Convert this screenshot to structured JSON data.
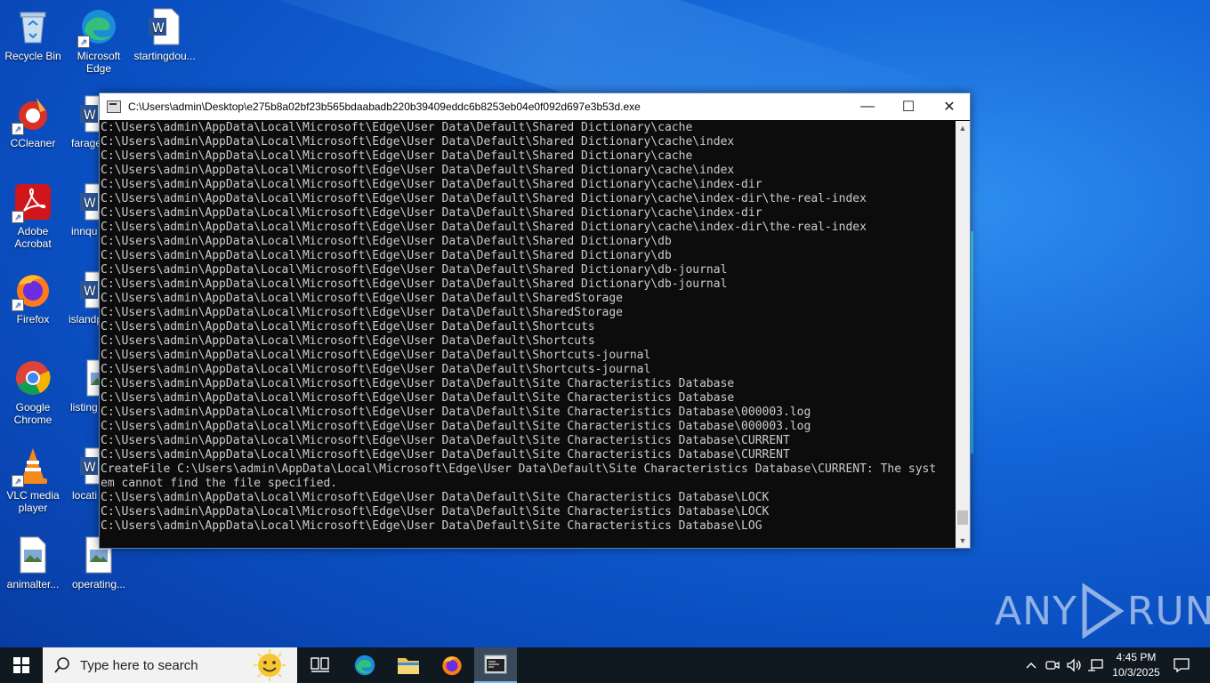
{
  "desktop": {
    "icons": [
      {
        "label": "Recycle Bin",
        "icon": "recycle-bin-icon"
      },
      {
        "label": "Microsoft Edge",
        "icon": "edge-icon"
      },
      {
        "label": "startingdou...",
        "icon": "word-doc-icon"
      },
      {
        "label": "CCleaner",
        "icon": "ccleaner-icon"
      },
      {
        "label": "farage",
        "icon": "word-doc-icon"
      },
      {
        "label": "Adobe Acrobat",
        "icon": "acrobat-icon"
      },
      {
        "label": "innqu",
        "icon": "word-doc-icon"
      },
      {
        "label": "Firefox",
        "icon": "firefox-icon"
      },
      {
        "label": "islandp",
        "icon": "word-doc-icon"
      },
      {
        "label": "Google Chrome",
        "icon": "chrome-icon"
      },
      {
        "label": "listing",
        "icon": "image-file-icon"
      },
      {
        "label": "VLC media player",
        "icon": "vlc-icon"
      },
      {
        "label": "locati",
        "icon": "word-doc-icon"
      },
      {
        "label": "animalter...",
        "icon": "image-file-icon"
      },
      {
        "label": "operating...",
        "icon": "image-file-icon"
      }
    ]
  },
  "console_window": {
    "title": "C:\\Users\\admin\\Desktop\\e275b8a02bf23b565bdaabadb220b39409eddc6b8253eb04e0f092d697e3b53d.exe",
    "minimize": "—",
    "maximize": "☐",
    "close": "✕",
    "lines": [
      "C:\\Users\\admin\\AppData\\Local\\Microsoft\\Edge\\User Data\\Default\\Shared Dictionary\\cache",
      "C:\\Users\\admin\\AppData\\Local\\Microsoft\\Edge\\User Data\\Default\\Shared Dictionary\\cache\\index",
      "C:\\Users\\admin\\AppData\\Local\\Microsoft\\Edge\\User Data\\Default\\Shared Dictionary\\cache",
      "C:\\Users\\admin\\AppData\\Local\\Microsoft\\Edge\\User Data\\Default\\Shared Dictionary\\cache\\index",
      "C:\\Users\\admin\\AppData\\Local\\Microsoft\\Edge\\User Data\\Default\\Shared Dictionary\\cache\\index-dir",
      "C:\\Users\\admin\\AppData\\Local\\Microsoft\\Edge\\User Data\\Default\\Shared Dictionary\\cache\\index-dir\\the-real-index",
      "C:\\Users\\admin\\AppData\\Local\\Microsoft\\Edge\\User Data\\Default\\Shared Dictionary\\cache\\index-dir",
      "C:\\Users\\admin\\AppData\\Local\\Microsoft\\Edge\\User Data\\Default\\Shared Dictionary\\cache\\index-dir\\the-real-index",
      "C:\\Users\\admin\\AppData\\Local\\Microsoft\\Edge\\User Data\\Default\\Shared Dictionary\\db",
      "C:\\Users\\admin\\AppData\\Local\\Microsoft\\Edge\\User Data\\Default\\Shared Dictionary\\db",
      "C:\\Users\\admin\\AppData\\Local\\Microsoft\\Edge\\User Data\\Default\\Shared Dictionary\\db-journal",
      "C:\\Users\\admin\\AppData\\Local\\Microsoft\\Edge\\User Data\\Default\\Shared Dictionary\\db-journal",
      "C:\\Users\\admin\\AppData\\Local\\Microsoft\\Edge\\User Data\\Default\\SharedStorage",
      "C:\\Users\\admin\\AppData\\Local\\Microsoft\\Edge\\User Data\\Default\\SharedStorage",
      "C:\\Users\\admin\\AppData\\Local\\Microsoft\\Edge\\User Data\\Default\\Shortcuts",
      "C:\\Users\\admin\\AppData\\Local\\Microsoft\\Edge\\User Data\\Default\\Shortcuts",
      "C:\\Users\\admin\\AppData\\Local\\Microsoft\\Edge\\User Data\\Default\\Shortcuts-journal",
      "C:\\Users\\admin\\AppData\\Local\\Microsoft\\Edge\\User Data\\Default\\Shortcuts-journal",
      "C:\\Users\\admin\\AppData\\Local\\Microsoft\\Edge\\User Data\\Default\\Site Characteristics Database",
      "C:\\Users\\admin\\AppData\\Local\\Microsoft\\Edge\\User Data\\Default\\Site Characteristics Database",
      "C:\\Users\\admin\\AppData\\Local\\Microsoft\\Edge\\User Data\\Default\\Site Characteristics Database\\000003.log",
      "C:\\Users\\admin\\AppData\\Local\\Microsoft\\Edge\\User Data\\Default\\Site Characteristics Database\\000003.log",
      "C:\\Users\\admin\\AppData\\Local\\Microsoft\\Edge\\User Data\\Default\\Site Characteristics Database\\CURRENT",
      "C:\\Users\\admin\\AppData\\Local\\Microsoft\\Edge\\User Data\\Default\\Site Characteristics Database\\CURRENT",
      "CreateFile C:\\Users\\admin\\AppData\\Local\\Microsoft\\Edge\\User Data\\Default\\Site Characteristics Database\\CURRENT: The syst",
      "em cannot find the file specified.",
      "C:\\Users\\admin\\AppData\\Local\\Microsoft\\Edge\\User Data\\Default\\Site Characteristics Database\\LOCK",
      "C:\\Users\\admin\\AppData\\Local\\Microsoft\\Edge\\User Data\\Default\\Site Characteristics Database\\LOCK",
      "C:\\Users\\admin\\AppData\\Local\\Microsoft\\Edge\\User Data\\Default\\Site Characteristics Database\\LOG"
    ]
  },
  "taskbar": {
    "search_placeholder": "Type here to search",
    "apps": [
      "task-view-icon",
      "edge-icon",
      "file-explorer-icon",
      "firefox-icon",
      "console-icon"
    ],
    "tray_icons": [
      "chevron-up-icon",
      "meet-now-icon",
      "volume-icon",
      "network-icon"
    ],
    "time": "4:45 PM",
    "date": "10/3/2025"
  },
  "watermark": {
    "left": "ANY",
    "right": "RUN"
  }
}
